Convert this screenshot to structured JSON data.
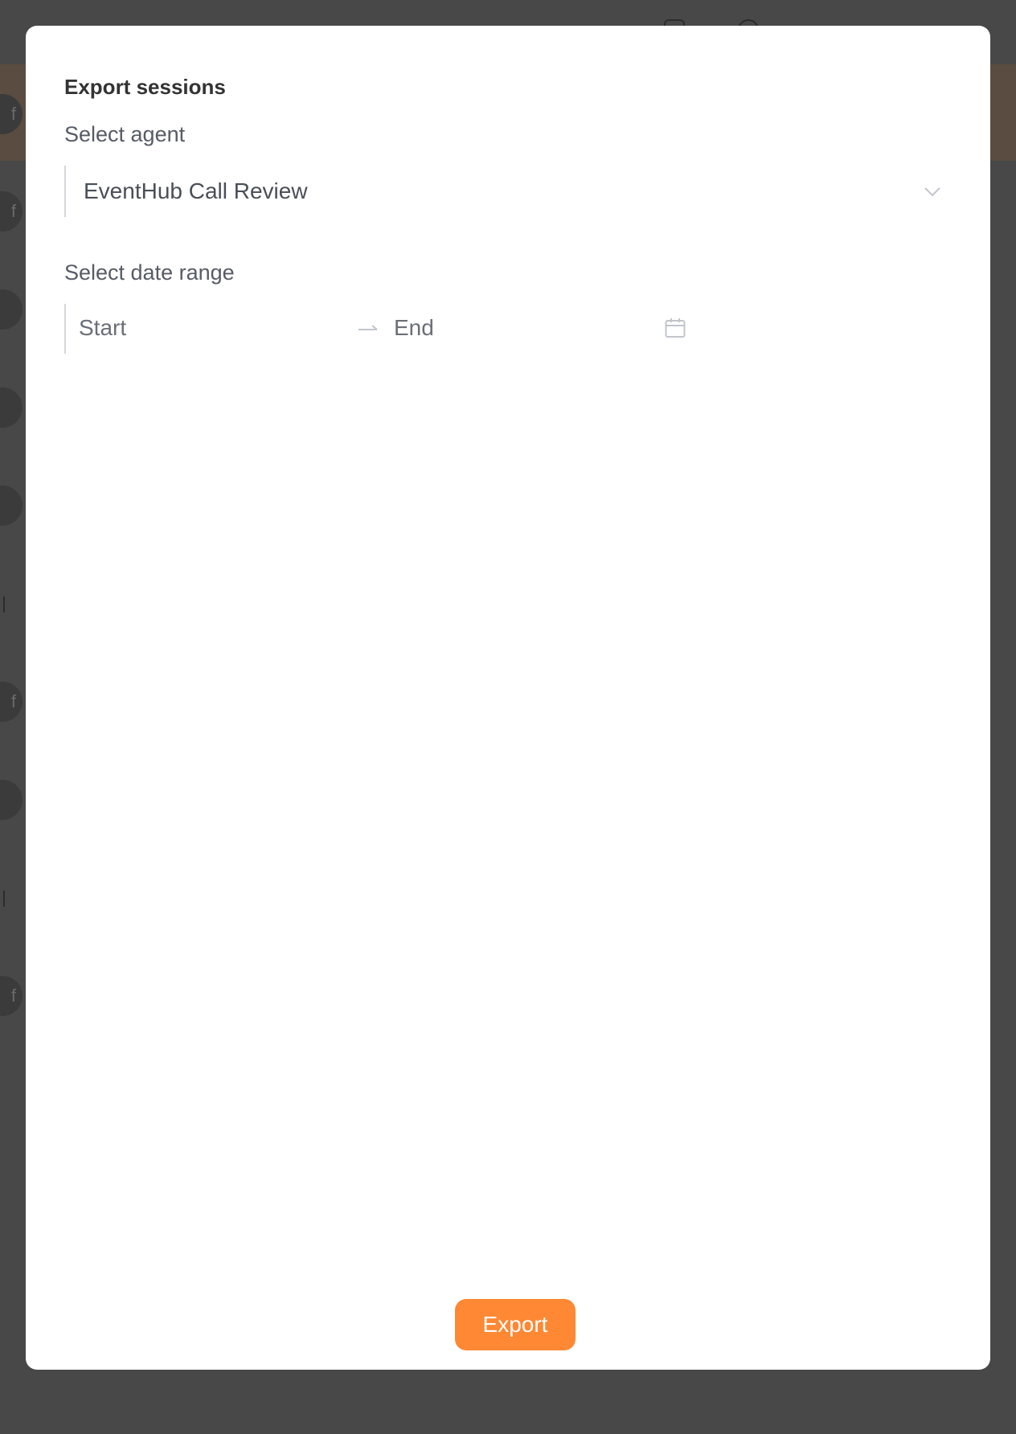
{
  "modal": {
    "title": "Export sessions",
    "agent_label": "Select agent",
    "agent_value": "EventHub Call Review",
    "range_label": "Select date range",
    "start_placeholder": "Start",
    "end_placeholder": "End",
    "export_label": "Export"
  },
  "colors": {
    "accent": "#fe8833",
    "overlay": "#484848"
  },
  "icons": {
    "select": "chevron-down-icon",
    "range_separator": "arrow-right-icon",
    "date_picker": "calendar-icon"
  }
}
